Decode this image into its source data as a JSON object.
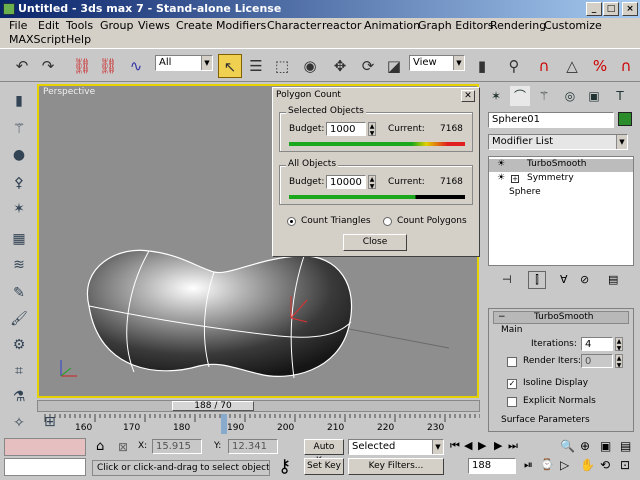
{
  "title": "Untitled - 3ds max 7 - Stand-alone License",
  "menus": [
    "File",
    "Edit",
    "Tools",
    "Group",
    "Views",
    "Create",
    "Modifiers",
    "Character",
    "reactor",
    "Animation",
    "Graph Editors",
    "Rendering",
    "Customize",
    "MAXScript",
    "Help"
  ],
  "toolbar": {
    "filter": "All",
    "coord": "View"
  },
  "viewport": {
    "label": "Perspective"
  },
  "polygon_count": {
    "title": "Polygon Count",
    "selected": {
      "label": "Selected Objects",
      "budget_label": "Budget:",
      "budget": "1000",
      "current_label": "Current:",
      "current": "7168"
    },
    "all": {
      "label": "All Objects",
      "budget_label": "Budget:",
      "budget": "10000",
      "current_label": "Current:",
      "current": "7168"
    },
    "count_triangles": "Count Triangles",
    "count_polygons": "Count Polygons",
    "close": "Close"
  },
  "command_panel": {
    "object_name": "Sphere01",
    "modifier_list": "Modifier List",
    "stack": [
      "TurboSmooth",
      "Symmetry",
      "Sphere"
    ],
    "rollout": {
      "title": "TurboSmooth",
      "main": "Main",
      "iterations_label": "Iterations:",
      "iterations": "4",
      "render_iters_label": "Render Iters:",
      "render_iters": "0",
      "isoline": "Isoline Display",
      "explicit_normals": "Explicit Normals",
      "surface": "Surface Parameters"
    }
  },
  "timeline": {
    "frame": "188 / 70",
    "ticks": [
      "160",
      "170",
      "180",
      "190",
      "200",
      "210",
      "220",
      "230"
    ]
  },
  "status": {
    "x_label": "X:",
    "x": "15.915",
    "y_label": "Y:",
    "y": "12.341",
    "autokey": "Auto Key",
    "selected": "Selected",
    "setkey": "Set Key",
    "keyfilters": "Key Filters...",
    "prompt": "Click or click-and-drag to select objects",
    "frame": "188"
  },
  "colors": {
    "accent": "#e6d200",
    "object": "#2a8c2a"
  }
}
